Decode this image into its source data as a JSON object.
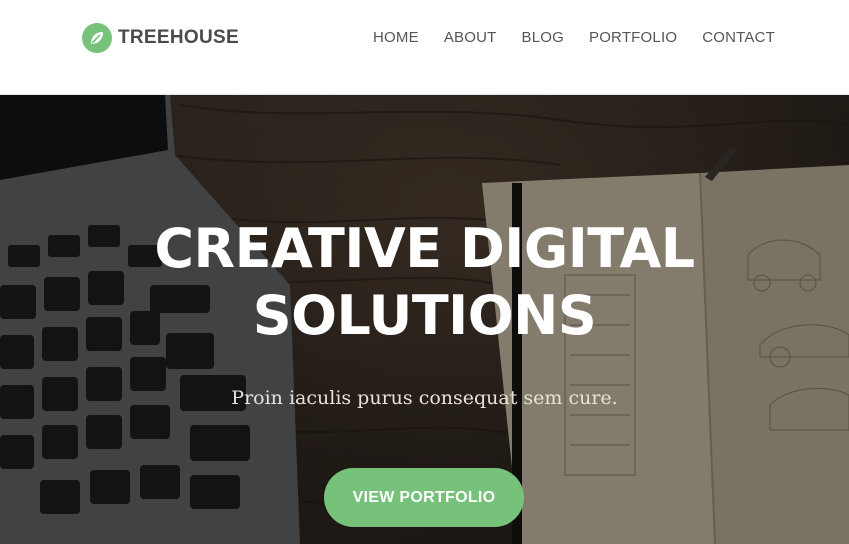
{
  "header": {
    "brand": "TREEHOUSE",
    "logo_icon": "leaf-icon",
    "nav": [
      {
        "label": "HOME"
      },
      {
        "label": "ABOUT"
      },
      {
        "label": "BLOG"
      },
      {
        "label": "PORTFOLIO"
      },
      {
        "label": "CONTACT"
      }
    ]
  },
  "hero": {
    "headline_line1": "CREATIVE DIGITAL",
    "headline_line2": "SOLUTIONS",
    "subtitle": "Proin iaculis purus consequat sem cure.",
    "cta_label": "VIEW PORTFOLIO"
  },
  "colors": {
    "accent": "#76c27a",
    "header_bg": "#ffffff",
    "nav_text": "#555555",
    "brand_text": "#4a4a4a"
  }
}
